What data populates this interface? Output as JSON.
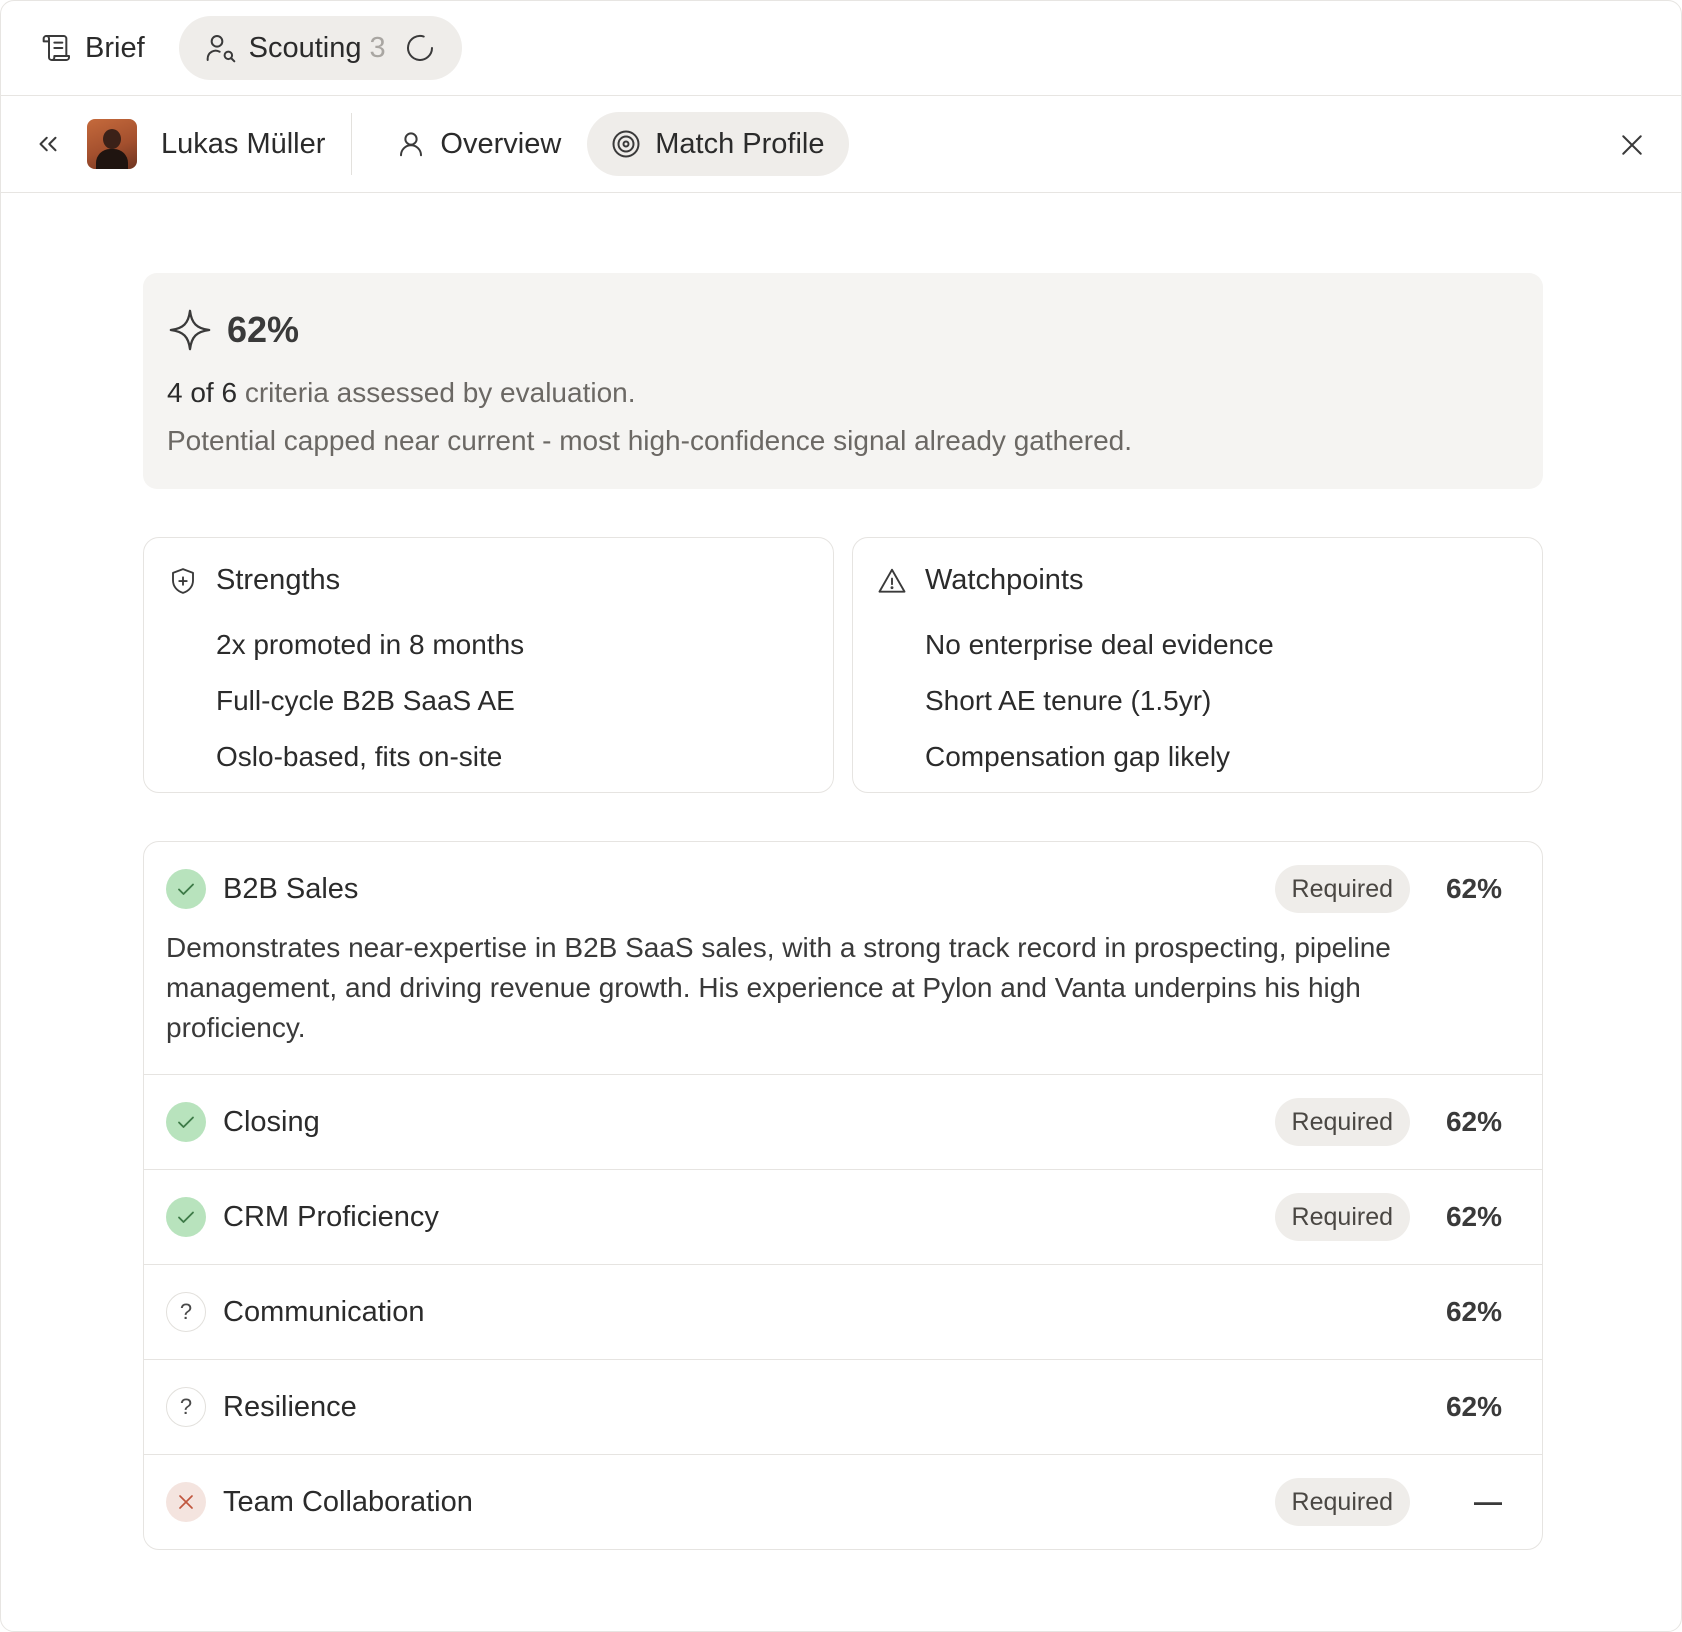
{
  "top_tabs": [
    {
      "label": "Brief",
      "icon": "scroll-icon"
    },
    {
      "label": "Scouting",
      "count": "3",
      "icon": "user-search-icon"
    }
  ],
  "header": {
    "person_name": "Lukas Müller",
    "tabs": [
      {
        "label": "Overview",
        "icon": "user-icon"
      },
      {
        "label": "Match Profile",
        "icon": "target-icon"
      }
    ]
  },
  "summary": {
    "score": "62%",
    "assessed": "4 of 6",
    "assessed_suffix": " criteria assessed by evaluation.",
    "note": "Potential capped near current - most high-confidence signal already gathered."
  },
  "strengths": {
    "title": "Strengths",
    "items": [
      "2x promoted in 8 months",
      "Full-cycle B2B SaaS AE",
      "Oslo-based, fits on-site"
    ]
  },
  "watchpoints": {
    "title": "Watchpoints",
    "items": [
      "No enterprise deal evidence",
      "Short AE tenure (1.5yr)",
      "Compensation gap likely"
    ]
  },
  "criteria": [
    {
      "name": "B2B Sales",
      "status": "met",
      "badge": "Required",
      "score": "62%",
      "description": "Demonstrates near-expertise in B2B SaaS sales, with a strong track record in prospecting, pipeline management, and driving revenue growth. His experience at Pylon and Vanta underpins his high proficiency."
    },
    {
      "name": "Closing",
      "status": "met",
      "badge": "Required",
      "score": "62%"
    },
    {
      "name": "CRM Proficiency",
      "status": "met",
      "badge": "Required",
      "score": "62%"
    },
    {
      "name": "Communication",
      "status": "unknown",
      "score": "62%"
    },
    {
      "name": "Resilience",
      "status": "unknown",
      "score": "62%"
    },
    {
      "name": "Team Collaboration",
      "status": "failed",
      "badge": "Required",
      "score": "—"
    }
  ],
  "colors": {
    "met": "#b8e3bd",
    "failed_x": "#c0573e",
    "chip_bg": "#efedea",
    "summary_bg": "#f5f4f2"
  }
}
